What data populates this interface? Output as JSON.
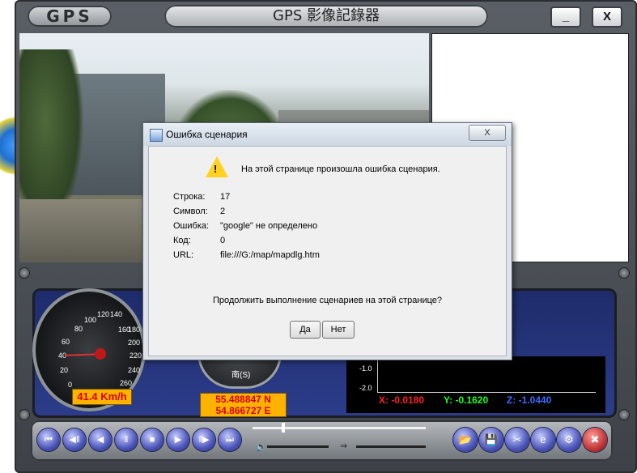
{
  "app": {
    "logo": "GPS",
    "title": "GPS 影像記錄器",
    "minimize_label": "_",
    "close_label": "X"
  },
  "speedometer": {
    "ticks": [
      "0",
      "20",
      "40",
      "60",
      "80",
      "100",
      "120",
      "140",
      "160",
      "180",
      "200",
      "220",
      "240",
      "260"
    ],
    "speed_readout": "41.4 Km/h"
  },
  "compass": {
    "direction": "南(S)"
  },
  "coordinates": {
    "lat": "55.488847 N",
    "lon": "54.866727 E"
  },
  "graph": {
    "y_labels": [
      "-1.0",
      "-2.0"
    ],
    "x_value": "X: -0.0180",
    "y_value": "Y: -0.1620",
    "z_value": "Z: -1.0440",
    "colors": {
      "x": "#ff2020",
      "y": "#20ff20",
      "z": "#3a6bff"
    }
  },
  "controls": {
    "buttons": [
      {
        "icon": "skip-back-icon",
        "glyph": "⏮"
      },
      {
        "icon": "step-back-icon",
        "glyph": "◀‖"
      },
      {
        "icon": "play-reverse-icon",
        "glyph": "◀"
      },
      {
        "icon": "pause-icon",
        "glyph": "‖"
      },
      {
        "icon": "stop-icon",
        "glyph": "■"
      },
      {
        "icon": "play-icon",
        "glyph": "▶"
      },
      {
        "icon": "step-forward-icon",
        "glyph": "‖▶"
      },
      {
        "icon": "skip-forward-icon",
        "glyph": "⏭"
      }
    ],
    "right_buttons": [
      {
        "icon": "open-folder-icon",
        "glyph": "📂"
      },
      {
        "icon": "save-icon",
        "glyph": "💾"
      },
      {
        "icon": "cut-icon",
        "glyph": "✂"
      },
      {
        "icon": "internet-explorer-icon",
        "glyph": "e"
      },
      {
        "icon": "settings-icon",
        "glyph": "⚙"
      },
      {
        "icon": "tools-icon",
        "glyph": "✖"
      }
    ]
  },
  "dialog": {
    "title": "Ошибка сценария",
    "close_label": "X",
    "message": "На этой странице произошла ошибка сценария.",
    "fields": [
      {
        "label": "Строка:",
        "value": "17"
      },
      {
        "label": "Символ:",
        "value": "2"
      },
      {
        "label": "Ошибка:",
        "value": "\"google\" не определено"
      },
      {
        "label": "Код:",
        "value": "0"
      },
      {
        "label": "URL:",
        "value": "file:///G:/map/mapdlg.htm"
      }
    ],
    "question": "Продолжить выполнение сценариев на этой странице?",
    "yes_label": "Да",
    "no_label": "Нет"
  }
}
